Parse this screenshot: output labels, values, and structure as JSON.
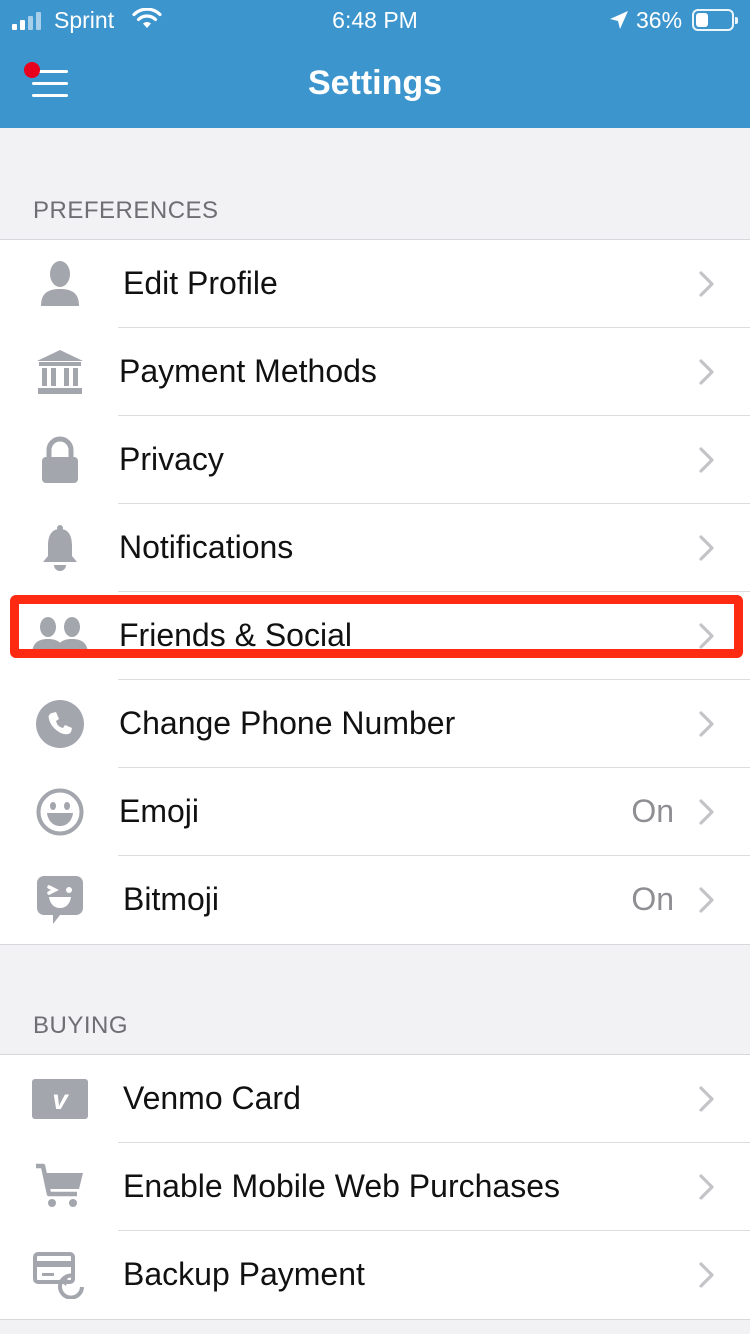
{
  "status_bar": {
    "carrier": "Sprint",
    "time": "6:48 PM",
    "battery_percent": "36%",
    "battery_level": 0.36,
    "signal_bars_on": 2,
    "signal_bars_total": 4
  },
  "header": {
    "title": "Settings",
    "background_color": "#3d95ce",
    "notification_dot_color": "#e8001c"
  },
  "preferences": {
    "section_label": "PREFERENCES",
    "items": [
      {
        "label": "Edit Profile",
        "icon": "person-icon",
        "value": ""
      },
      {
        "label": "Payment Methods",
        "icon": "bank-icon",
        "value": ""
      },
      {
        "label": "Privacy",
        "icon": "lock-icon",
        "value": ""
      },
      {
        "label": "Notifications",
        "icon": "bell-icon",
        "value": ""
      },
      {
        "label": "Friends & Social",
        "icon": "friends-icon",
        "value": ""
      },
      {
        "label": "Change Phone Number",
        "icon": "phone-icon",
        "value": ""
      },
      {
        "label": "Emoji",
        "icon": "smiley-icon",
        "value": "On"
      },
      {
        "label": "Bitmoji",
        "icon": "bitmoji-icon",
        "value": "On"
      }
    ]
  },
  "buying": {
    "section_label": "BUYING",
    "items": [
      {
        "label": "Venmo Card",
        "icon": "venmo-card-icon",
        "value": ""
      },
      {
        "label": "Enable Mobile Web Purchases",
        "icon": "cart-icon",
        "value": ""
      },
      {
        "label": "Backup Payment",
        "icon": "backup-card-icon",
        "value": ""
      }
    ]
  },
  "highlight_color": "#ff2a12"
}
